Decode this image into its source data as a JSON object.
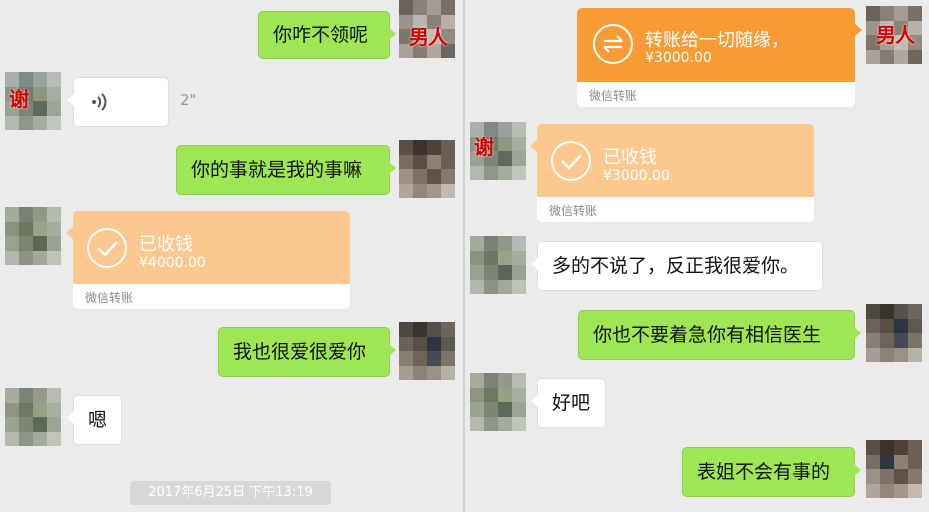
{
  "left": {
    "msg1": "你咋不领呢",
    "voice_duration": "2\"",
    "msg2": "你的事就是我的事嘛",
    "transfer": {
      "status": "已收钱",
      "amount": "¥4000.00",
      "footer": "微信转账"
    },
    "msg3": "我也很爱很爱你",
    "msg4": "嗯",
    "timestamp": "2017年6月25日 下午13:19",
    "avatar_me_tag": "男人",
    "avatar_other_tag": "谢"
  },
  "right": {
    "transfer_sent": {
      "title": "转账给一切随缘，",
      "amount": "¥3000.00",
      "footer": "微信转账"
    },
    "transfer_received": {
      "status": "已收钱",
      "amount": "¥3000.00",
      "footer": "微信转账"
    },
    "msg1": "多的不说了，反正我很爱你。",
    "msg2": "你也不要着急你有相信医生",
    "msg3": "好吧",
    "msg4": "表姐不会有事的",
    "avatar_me_tag": "男人",
    "avatar_other_tag": "谢"
  },
  "colors": {
    "green_bubble": "#9ee653",
    "transfer_sent": "#f79c35",
    "transfer_received": "#fcc88f",
    "background": "#ebebeb"
  }
}
